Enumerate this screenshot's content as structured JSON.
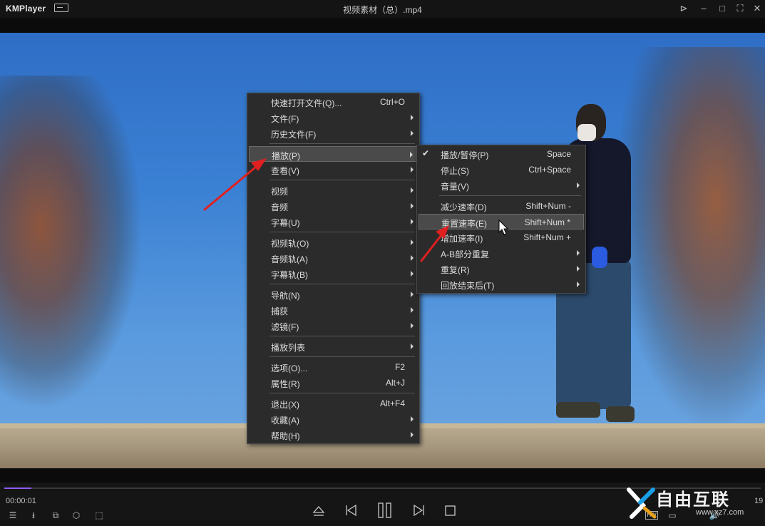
{
  "app": {
    "name": "KMPlayer",
    "window_title": "视频素材（总）.mp4",
    "window_controls": [
      "pin-icon",
      "minimize-icon",
      "maximize-icon",
      "fullscreen-icon",
      "close-icon"
    ]
  },
  "main_menu": {
    "items": [
      {
        "label": "快速打开文件(Q)...",
        "shortcut": "Ctrl+O",
        "submenu": false
      },
      {
        "label": "文件(F)",
        "shortcut": "",
        "submenu": true
      },
      {
        "label": "历史文件(F)",
        "shortcut": "",
        "submenu": true
      },
      {
        "label": "播放(P)",
        "shortcut": "",
        "submenu": true,
        "highlighted": true
      },
      {
        "label": "查看(V)",
        "shortcut": "",
        "submenu": true
      },
      {
        "label": "视频",
        "shortcut": "",
        "submenu": true
      },
      {
        "label": "音频",
        "shortcut": "",
        "submenu": true
      },
      {
        "label": "字幕(U)",
        "shortcut": "",
        "submenu": true
      },
      {
        "label": "视频轨(O)",
        "shortcut": "",
        "submenu": true
      },
      {
        "label": "音频轨(A)",
        "shortcut": "",
        "submenu": true
      },
      {
        "label": "字幕轨(B)",
        "shortcut": "",
        "submenu": true
      },
      {
        "label": "导航(N)",
        "shortcut": "",
        "submenu": true
      },
      {
        "label": "捕获",
        "shortcut": "",
        "submenu": true
      },
      {
        "label": "滤镜(F)",
        "shortcut": "",
        "submenu": true
      },
      {
        "label": "播放列表",
        "shortcut": "",
        "submenu": true
      },
      {
        "label": "选项(O)...",
        "shortcut": "F2",
        "submenu": false
      },
      {
        "label": "属性(R)",
        "shortcut": "Alt+J",
        "submenu": false
      },
      {
        "label": "退出(X)",
        "shortcut": "Alt+F4",
        "submenu": false
      },
      {
        "label": "收藏(A)",
        "shortcut": "",
        "submenu": true
      },
      {
        "label": "帮助(H)",
        "shortcut": "",
        "submenu": true
      }
    ]
  },
  "play_submenu": {
    "items": [
      {
        "label": "播放/暂停(P)",
        "shortcut": "Space",
        "submenu": false,
        "checked": true
      },
      {
        "label": "停止(S)",
        "shortcut": "Ctrl+Space",
        "submenu": false
      },
      {
        "label": "音量(V)",
        "shortcut": "",
        "submenu": true
      },
      {
        "label": "减少速率(D)",
        "shortcut": "Shift+Num -",
        "submenu": false
      },
      {
        "label": "重置速率(E)",
        "shortcut": "Shift+Num *",
        "submenu": false,
        "highlighted": true
      },
      {
        "label": "增加速率(I)",
        "shortcut": "Shift+Num +",
        "submenu": false
      },
      {
        "label": "A-B部分重复",
        "shortcut": "",
        "submenu": true
      },
      {
        "label": "重复(R)",
        "shortcut": "",
        "submenu": true
      },
      {
        "label": "回放结束后(T)",
        "shortcut": "",
        "submenu": true
      }
    ]
  },
  "player": {
    "current_time": "00:00:01",
    "total_time_partial": "19",
    "progress_fraction": 0.036,
    "left_icons": [
      "playlist-icon",
      "open-folder-icon",
      "vr-icon",
      "3d-cube-icon",
      "capture-icon"
    ],
    "center_icons": [
      "eject-icon",
      "previous-icon",
      "pause-icon",
      "next-icon",
      "stop-icon"
    ],
    "hw_badge": "HW"
  },
  "watermark": {
    "brand": "自由互联",
    "site": "www.xz7.com"
  },
  "colors": {
    "titlebar": "#141414",
    "menu_bg": "#2b2b2b",
    "menu_highlight": "#4a4a4a",
    "seek_accent": "#8b5cf6",
    "annotation_arrow": "#e02020"
  }
}
